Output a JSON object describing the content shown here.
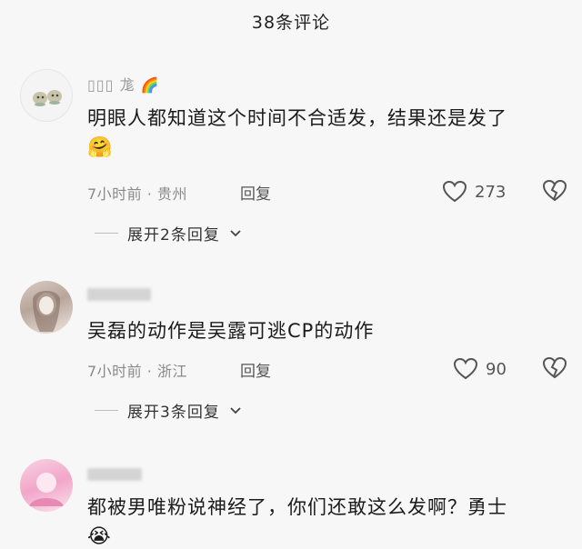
{
  "header": {
    "title": "38条评论"
  },
  "comments": [
    {
      "username": "▯▯▯ 尨",
      "badge": "🌈",
      "text": "明眼人都知道这个时间不合适发，结果还是发了",
      "emoji": "🤗",
      "meta": "7小时前 · 贵州",
      "reply_label": "回复",
      "likes": "273",
      "expand_label": "展开2条回复"
    },
    {
      "text": "吴磊的动作是吴露可逃CP的动作",
      "meta": "7小时前 · 浙江",
      "reply_label": "回复",
      "likes": "90",
      "expand_label": "展开3条回复"
    },
    {
      "text": "都被男唯粉说神经了，你们还敢这么发啊？勇士",
      "emoji": "😭"
    }
  ],
  "icons": {
    "like": "heart-outline-icon",
    "dislike": "broken-heart-icon",
    "expand": "chevron-down-icon"
  }
}
